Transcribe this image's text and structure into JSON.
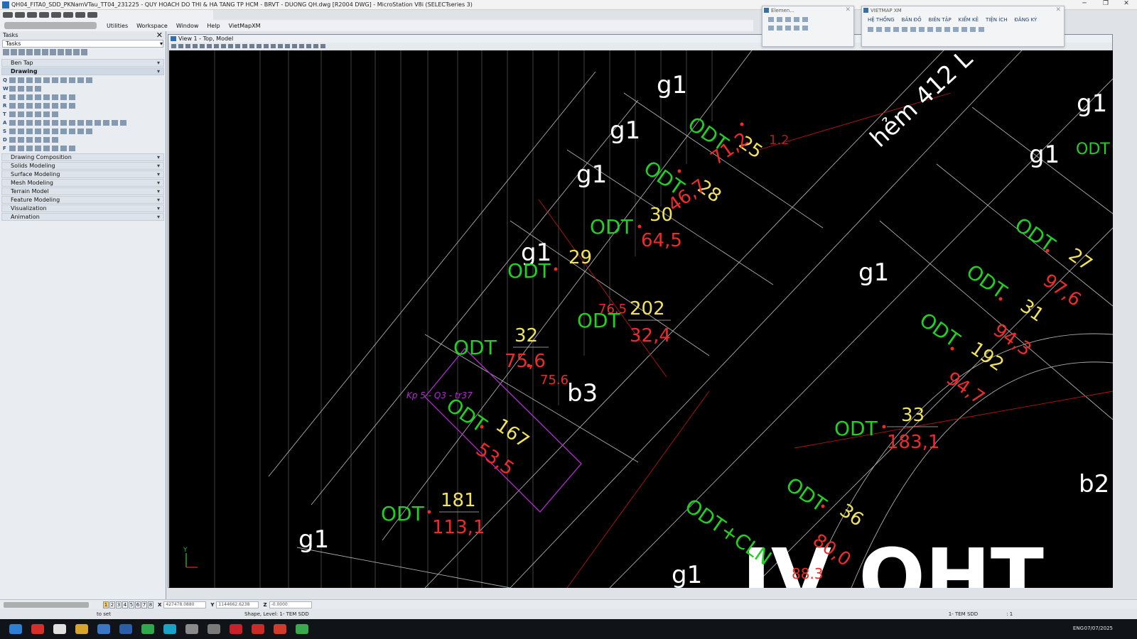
{
  "window": {
    "title": "QH04_FITA0_SDD_PKNamVTau_TT04_231225 - QUY HOACH DO THI & HA TANG TP HCM - BRVT - DUONG QH.dwg [R2004 DWG] - MicroStation V8i (SELECTseries 3)"
  },
  "menu": {
    "items": [
      "Utilities",
      "Workspace",
      "Window",
      "Help",
      "VietMapXM"
    ]
  },
  "tasks_panel": {
    "header": "Tasks",
    "tasks_field": "Tasks",
    "ben_tap": "Ben Tap",
    "drawing": "Drawing",
    "row_letters": [
      "Q",
      "W",
      "E",
      "R",
      "T",
      "A",
      "S",
      "D",
      "F"
    ],
    "sections": [
      "Drawing Composition",
      "Solids Modeling",
      "Surface Modeling",
      "Mesh Modeling",
      "Terrain Model",
      "Feature Modeling",
      "Visualization",
      "Animation"
    ]
  },
  "view": {
    "title": "View 1 - Top, Model"
  },
  "element_panel": {
    "title": "Elemen..."
  },
  "vietmap_panel": {
    "title": "VIETMAP XM",
    "menu": [
      "HỆ THỐNG",
      "BẢN ĐỒ",
      "BIÊN TẬP",
      "KIỂM KÊ",
      "TIỆN ÍCH",
      "ĐĂNG KÝ"
    ]
  },
  "drawing": {
    "street_label": "hẻm 412 L",
    "zone_labels": [
      "g1",
      "g1",
      "g1",
      "g1",
      "g1",
      "g1",
      "g1",
      "g1",
      "g1",
      "b3",
      "b2"
    ],
    "big_text": "IV  OHT",
    "parcels": [
      {
        "land": "ODT",
        "number": "25",
        "area": "71,2",
        "extra": "1.2"
      },
      {
        "land": "ODT",
        "number": "28",
        "area": "46,7"
      },
      {
        "land": "ODT",
        "number": "30",
        "area": "64,5"
      },
      {
        "land": "ODT",
        "number": "29",
        "area": ""
      },
      {
        "land": "ODT",
        "number": "202",
        "area": "32,4",
        "extra": "76.5"
      },
      {
        "land": "ODT",
        "number": "32",
        "area": "75,6",
        "extra": "75.6"
      },
      {
        "land": "ODT",
        "number": "167",
        "area": "53,5"
      },
      {
        "land": "ODT",
        "number": "181",
        "area": "113,1"
      },
      {
        "land": "ODT",
        "number": "27",
        "area": "97,6"
      },
      {
        "land": "ODT",
        "number": "31",
        "area": "94,3"
      },
      {
        "land": "ODT",
        "number": "192",
        "area": "94,7"
      },
      {
        "land": "ODT",
        "number": "33",
        "area": "183,1"
      },
      {
        "land": "ODT",
        "number": "36",
        "area": "80,0"
      },
      {
        "land": "ODT+CLN",
        "number": "",
        "area": "88.3"
      }
    ],
    "boundary_note": "Kp 5 - Q3 - tr37",
    "odt_right": "ODT"
  },
  "coords": {
    "x_label": "X",
    "x_value": "427478.0880",
    "y_label": "Y",
    "y_value": "1144662.6238",
    "z_label": "Z",
    "z_value": "-0.0000",
    "view_numbers": [
      "1",
      "2",
      "3",
      "4",
      "5",
      "6",
      "7",
      "8"
    ]
  },
  "status": {
    "prompt": "to set",
    "message": "Shape, Level: 1- TEM SDD",
    "level": "1- TEM SDD",
    "scale": ": 1"
  },
  "taskbar": {
    "lang": "ENG",
    "date": "07/07/2025"
  },
  "colors": {
    "canvas_bg": "#000000",
    "land_use_text": "#21d121",
    "parcel_number": "#f2e35a",
    "area_text": "#ee2b2b",
    "boundary": "#b32bd1"
  }
}
